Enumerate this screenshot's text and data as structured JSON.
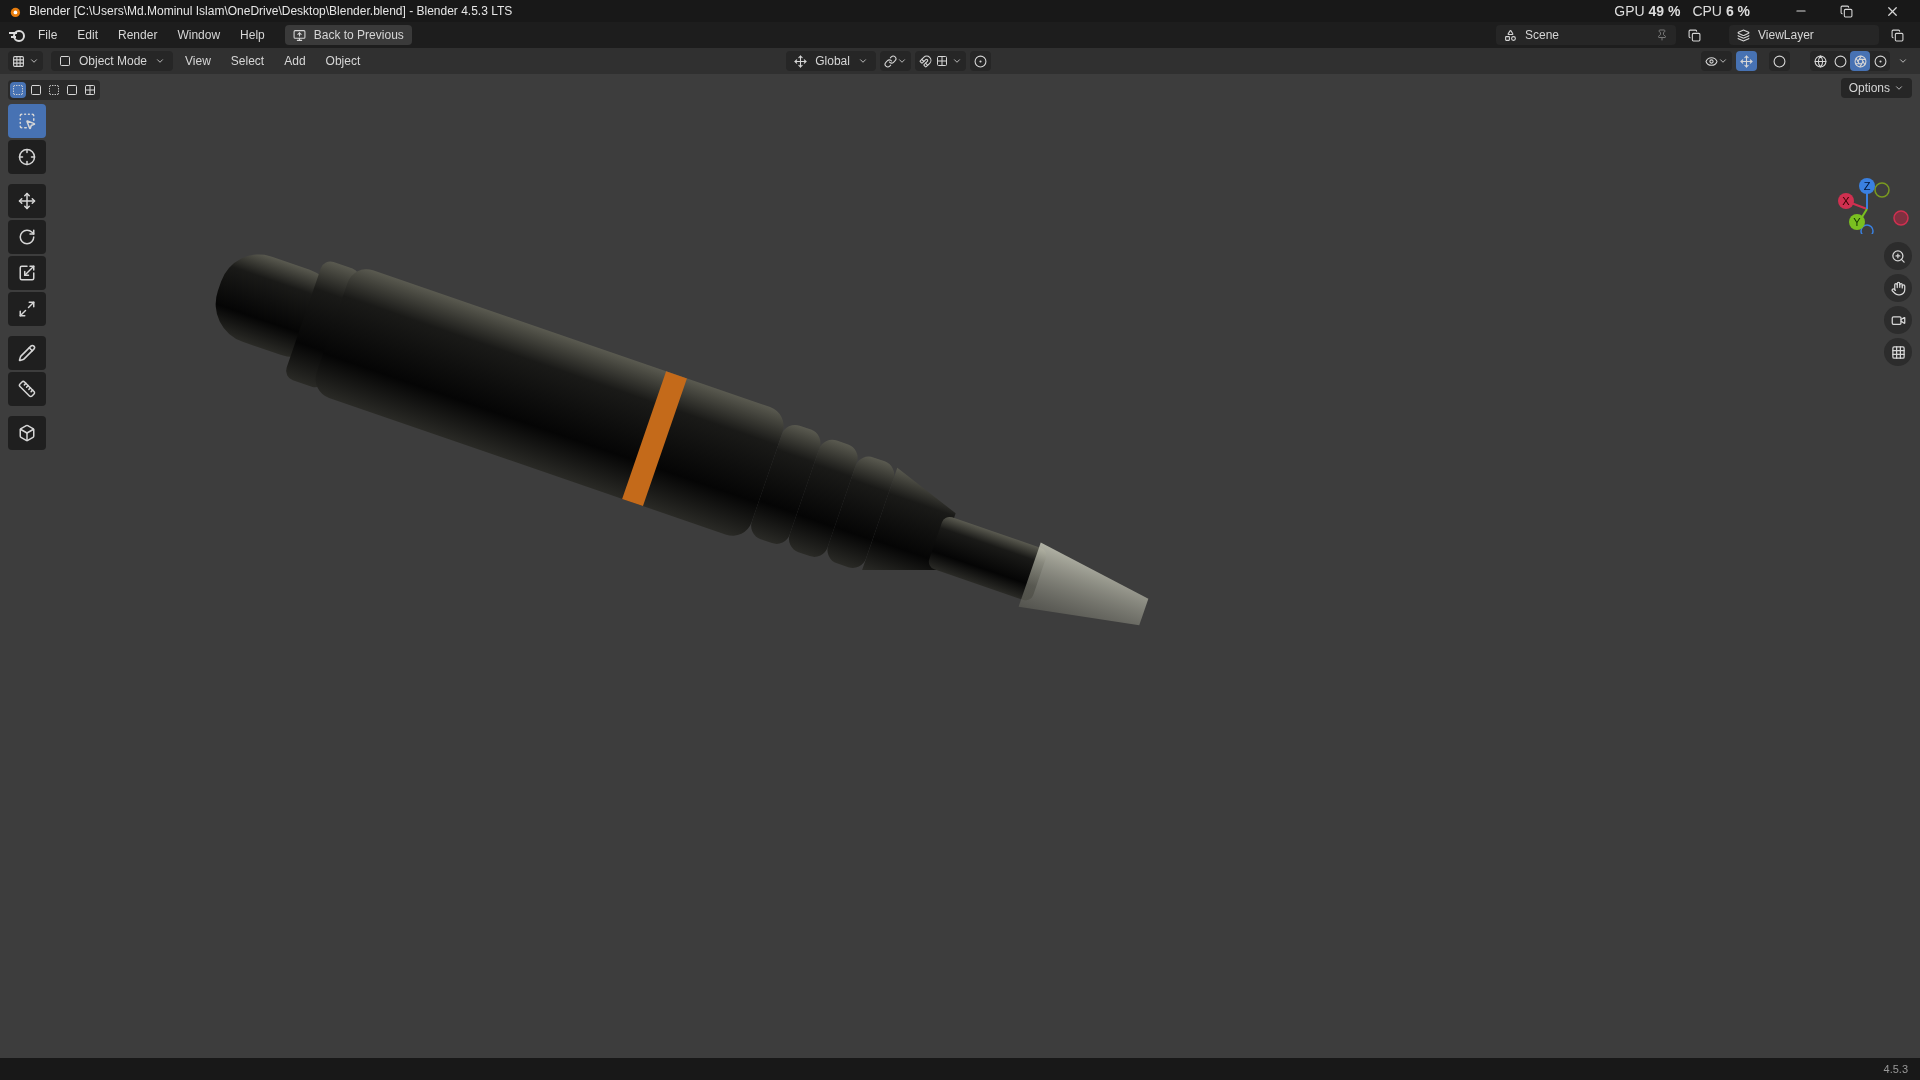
{
  "window": {
    "title": "Blender [C:\\Users\\Md.Mominul Islam\\OneDrive\\Desktop\\Blender.blend] - Blender 4.5.3 LTS"
  },
  "menu_bar": {
    "items": [
      "File",
      "Edit",
      "Render",
      "Window",
      "Help"
    ],
    "back_button": "Back to Previous"
  },
  "scene": {
    "value": "Scene"
  },
  "view_layer": {
    "value": "ViewLayer"
  },
  "performance": [
    {
      "label": "GPU",
      "value": "49 %"
    },
    {
      "label": "CPU",
      "value": "6 %"
    }
  ],
  "viewport_header": {
    "mode": "Object Mode",
    "menus": [
      "View",
      "Select",
      "Add",
      "Object"
    ],
    "orientation": "Global",
    "gizmos_on": true,
    "shading": [
      {
        "kind": "wireframe",
        "selected": false
      },
      {
        "kind": "solid",
        "selected": false
      },
      {
        "kind": "material",
        "selected": true
      },
      {
        "kind": "rendered",
        "selected": false
      }
    ]
  },
  "select_modes": [
    {
      "kind": "new",
      "selected": true
    },
    {
      "kind": "extend",
      "selected": false
    },
    {
      "kind": "subtract",
      "selected": false
    },
    {
      "kind": "invert",
      "selected": false
    },
    {
      "kind": "intersect",
      "selected": false
    }
  ],
  "options_button": "Options",
  "tools": [
    {
      "kind": "select",
      "selected": true
    },
    {
      "kind": "cursor",
      "selected": false
    },
    {
      "kind": "move",
      "selected": false
    },
    {
      "kind": "rotate",
      "selected": false
    },
    {
      "kind": "scale",
      "selected": false
    },
    {
      "kind": "transform",
      "selected": false
    },
    {
      "kind": "annotate",
      "selected": false
    },
    {
      "kind": "measure",
      "selected": false
    },
    {
      "kind": "add-cube",
      "selected": false
    }
  ],
  "gizmo": {
    "axes": [
      "X",
      "Y",
      "Z"
    ]
  },
  "status_bar": {
    "version": "4.5.3"
  }
}
